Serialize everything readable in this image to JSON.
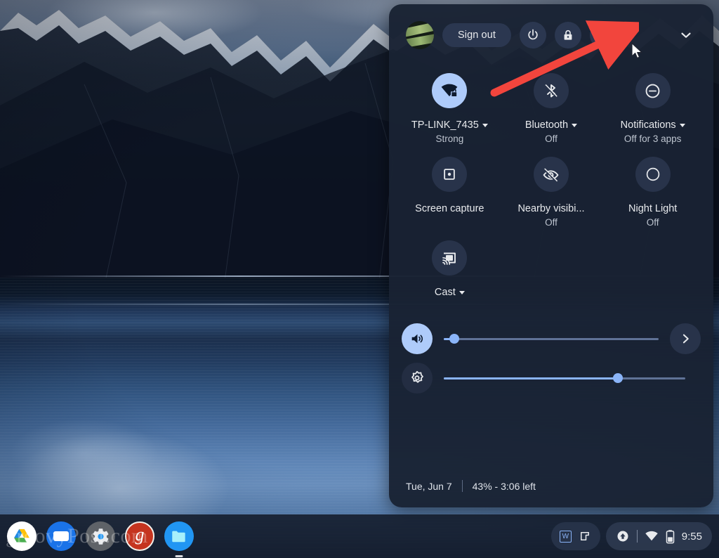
{
  "wallpaper": {
    "description": "dark mountain lake at dusk"
  },
  "tray": {
    "header": {
      "avatar_name": "user-avatar",
      "sign_out_label": "Sign out",
      "power_label": "power-icon",
      "lock_label": "lock-icon",
      "settings_label": "gear-icon",
      "collapse_label": "chevron-down-icon"
    },
    "tiles": [
      {
        "name": "network",
        "icon": "wifi-locked-icon",
        "label": "TP-LINK_7435",
        "sublabel": "Strong",
        "has_caret": true,
        "active": true
      },
      {
        "name": "bluetooth",
        "icon": "bluetooth-off-icon",
        "label": "Bluetooth",
        "sublabel": "Off",
        "has_caret": true,
        "active": false
      },
      {
        "name": "notifications",
        "icon": "do-not-disturb-icon",
        "label": "Notifications",
        "sublabel": "Off for 3 apps",
        "has_caret": true,
        "active": false
      },
      {
        "name": "screen-capture",
        "icon": "screen-capture-icon",
        "label": "Screen capture",
        "sublabel": "",
        "has_caret": false,
        "active": false
      },
      {
        "name": "nearby-visibility",
        "icon": "eye-off-icon",
        "label": "Nearby visibi...",
        "sublabel": "Off",
        "has_caret": false,
        "active": false
      },
      {
        "name": "night-light",
        "icon": "night-light-icon",
        "label": "Night Light",
        "sublabel": "Off",
        "has_caret": false,
        "active": false
      },
      {
        "name": "cast",
        "icon": "cast-icon",
        "label": "Cast",
        "sublabel": "",
        "has_caret": true,
        "active": false
      }
    ],
    "sliders": {
      "volume": {
        "name": "volume-slider",
        "icon": "volume-icon",
        "value": 5,
        "next_label": "chevron-right-icon"
      },
      "brightness": {
        "name": "brightness-slider",
        "icon": "brightness-icon",
        "value": 72
      }
    },
    "footer": {
      "date": "Tue, Jun 7",
      "battery": "43% - 3:06 left"
    }
  },
  "annotation": {
    "arrow": "red-arrow pointing at settings gear",
    "cursor": "mouse-pointer"
  },
  "shelf": {
    "apps": [
      {
        "name": "google-drive",
        "label": "Google Drive",
        "active": false
      },
      {
        "name": "app-blue",
        "label": "App",
        "active": false
      },
      {
        "name": "settings",
        "label": "Settings",
        "active": false
      },
      {
        "name": "groovypost",
        "label": "g",
        "active": false
      },
      {
        "name": "files",
        "label": "Files",
        "active": true
      }
    ],
    "watermark": "groovyPost.com",
    "status": {
      "window_badge": "W",
      "window_icon": "window-restore-icon",
      "update_icon": "update-available-icon",
      "wifi_icon": "wifi-icon",
      "battery_icon": "battery-icon",
      "time": "9:55"
    }
  },
  "colors": {
    "accent": "#8ab4f8",
    "tile_active": "#aecbfa",
    "panel": "#192233",
    "arrow": "#f2453d"
  }
}
